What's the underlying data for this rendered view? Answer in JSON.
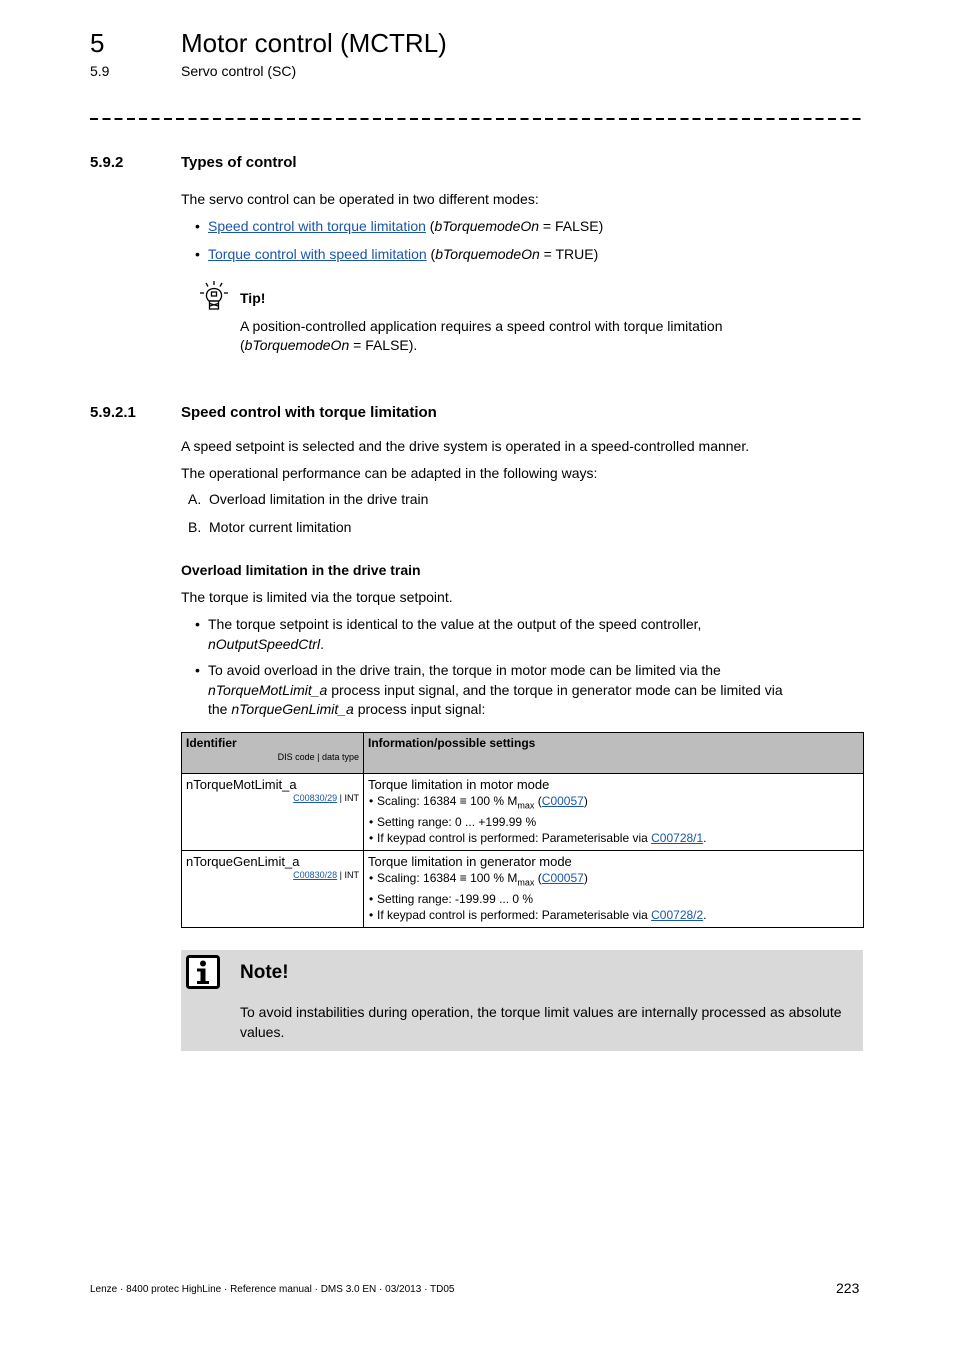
{
  "header": {
    "chapter_number": "5",
    "chapter_title": "Motor control (MCTRL)",
    "section_number": "5.9",
    "section_title": "Servo control (SC)"
  },
  "section_592": {
    "number": "5.9.2",
    "title": "Types of control",
    "intro": "The servo control can be operated in two different modes:",
    "modes": [
      {
        "link": "Speed control with torque limitation",
        "open": " (",
        "var": "bTorquemodeOn",
        "value": " = FALSE)"
      },
      {
        "link": "Torque control with speed limitation",
        "open": " (",
        "var": "bTorquemodeOn",
        "value": " = TRUE)"
      }
    ],
    "tip": {
      "icon": "lightbulb-icon",
      "label": "Tip!",
      "text_line1": "A position-controlled application requires a speed control with torque limitation",
      "text_open": "(",
      "text_var": "bTorquemodeOn",
      "text_close": " = FALSE)."
    }
  },
  "section_5921": {
    "number": "5.9.2.1",
    "title": "Speed control with torque limitation",
    "p1": "A speed setpoint is selected and the drive system is operated in a speed-controlled manner.",
    "p2": "The operational performance can be adapted in the following ways:",
    "ways": [
      {
        "letter": "A.",
        "text": "Overload limitation in the drive train"
      },
      {
        "letter": "B.",
        "text": "Motor current limitation"
      }
    ],
    "subheading": "Overload limitation in the drive train",
    "p3": "The torque is limited via the torque setpoint.",
    "bullets": {
      "b1_text": "The torque setpoint is identical to the value at the output of the speed controller,",
      "b1_var": "nOutputSpeedCtrl",
      "b1_end": ".",
      "b2_text1": "To avoid overload in the drive train, the torque in motor mode can be limited via the",
      "b2_var1": "nTorqueMotLimit_a",
      "b2_text2": " process input signal, and the torque in generator mode can be limited via",
      "b2_text3": "the ",
      "b2_var2": "nTorqueGenLimit_a",
      "b2_text4": " process input signal:"
    }
  },
  "table": {
    "header_identifier": "Identifier",
    "header_sub": "DIS code | data type",
    "header_info": "Information/possible settings",
    "rows": [
      {
        "identifier": "nTorqueMotLimit_a",
        "code": "C00830/29",
        "type": " | INT",
        "title": "Torque limitation in motor mode",
        "scaling_pre": "Scaling: 16384 ≡ 100 % M",
        "scaling_sub": "max",
        "scaling_link": "C00057",
        "range": "Setting range: 0 ... +199.99 %",
        "keypad_pre": "If keypad control is performed: Parameterisable via ",
        "keypad_link": "C00728/1"
      },
      {
        "identifier": "nTorqueGenLimit_a",
        "code": "C00830/28",
        "type": " | INT",
        "title": "Torque limitation in generator mode",
        "scaling_pre": "Scaling: 16384 ≡ 100 % M",
        "scaling_sub": "max",
        "scaling_link": "C00057",
        "range": "Setting range: -199.99 ... 0 %",
        "keypad_pre": "If keypad control is performed: Parameterisable via ",
        "keypad_link": "C00728/2"
      }
    ]
  },
  "note": {
    "icon": "info-icon",
    "title": "Note!",
    "text": "To avoid instabilities during operation, the torque limit values are internally processed as absolute values."
  },
  "footer": {
    "text": "Lenze · 8400 protec HighLine · Reference manual · DMS 3.0 EN · 03/2013 · TD05",
    "page": "223"
  }
}
